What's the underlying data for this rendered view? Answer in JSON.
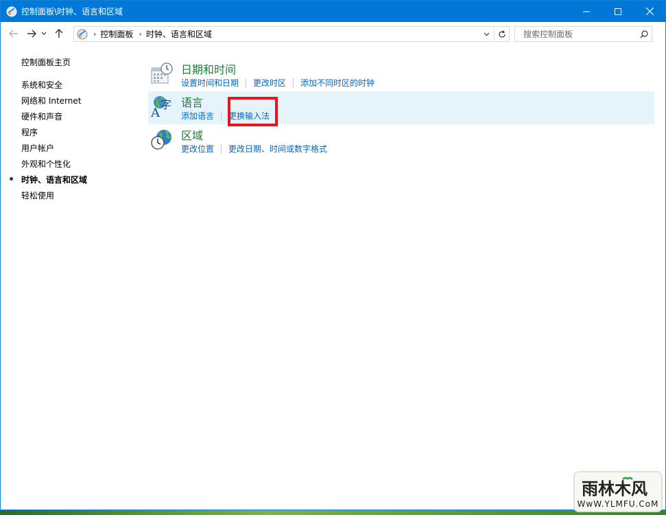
{
  "window": {
    "title": "控制面板\\时钟、语言和区域"
  },
  "address": {
    "segments": [
      "控制面板",
      "时钟、语言和区域"
    ]
  },
  "search": {
    "placeholder": "搜索控制面板"
  },
  "sidebar": {
    "items": [
      {
        "label": "控制面板主页"
      },
      {
        "label": "系统和安全"
      },
      {
        "label": "网络和 Internet"
      },
      {
        "label": "硬件和声音"
      },
      {
        "label": "程序"
      },
      {
        "label": "用户帐户"
      },
      {
        "label": "外观和个性化"
      },
      {
        "label": "时钟、语言和区域"
      },
      {
        "label": "轻松使用"
      }
    ]
  },
  "categories": [
    {
      "title": "日期和时间",
      "icon": "calendar-clock-icon",
      "links": [
        "设置时间和日期",
        "更改时区",
        "添加不同时区的时钟"
      ]
    },
    {
      "title": "语言",
      "icon": "language-globe-icon",
      "links": [
        "添加语言",
        "更换输入法"
      ]
    },
    {
      "title": "区域",
      "icon": "region-globe-clock-icon",
      "links": [
        "更改位置",
        "更改日期、时间或数字格式"
      ]
    }
  ],
  "watermark": {
    "url": "WwW.YLMFU.CoM",
    "logo_text": "雨林木风"
  },
  "colors": {
    "titlebar": "#0078d7",
    "link": "#0066cc",
    "category_title": "#1e7b34",
    "highlight": "#e5f3fb",
    "annotation_box": "#e8141b"
  }
}
